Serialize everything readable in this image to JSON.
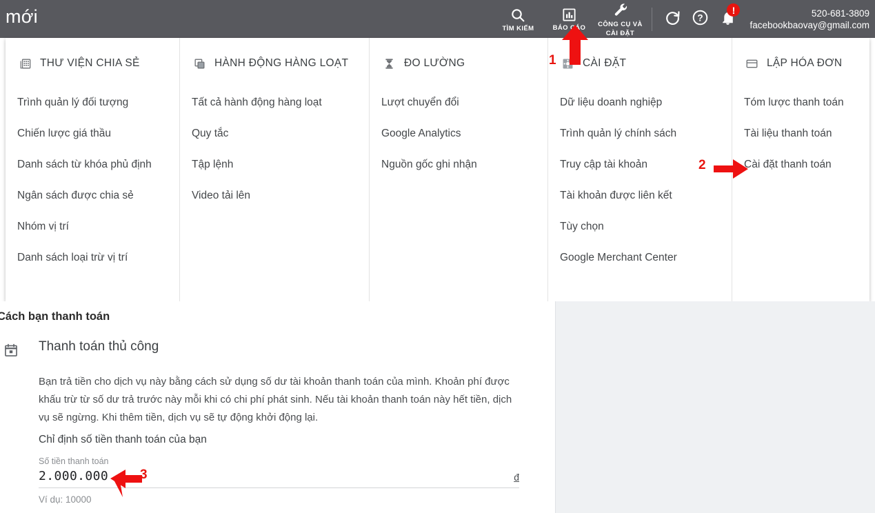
{
  "header": {
    "brand": "mới",
    "tools": [
      {
        "label": "TÌM KIẾM",
        "icon": "search-icon"
      },
      {
        "label": "BÁO CÁO",
        "icon": "reports-bar-chart-icon"
      },
      {
        "label": "CÔNG CỤ VÀ CÀI ĐẶT",
        "label_line1": "CÔNG CỤ VÀ",
        "label_line2": "CÀI ĐẶT",
        "icon": "wrench-tools-icon"
      }
    ],
    "refresh_icon": "refresh-icon",
    "help_icon": "help-question-icon",
    "notifications_icon": "bell-icon",
    "notifications_badge": "!",
    "account_id": "520-681-3809",
    "account_email": "facebookbaovay@gmail.com",
    "bar_color": "#58595e"
  },
  "megamenu": {
    "columns": [
      {
        "title": "THƯ VIỆN CHIA SẺ",
        "icon": "shared-library-grid-icon",
        "items": [
          "Trình quản lý đối tượng",
          "Chiến lược giá thầu",
          "Danh sách từ khóa phủ định",
          "Ngân sách được chia sẻ",
          "Nhóm vị trí",
          "Danh sách loại trừ vị trí"
        ]
      },
      {
        "title": "HÀNH ĐỘNG HÀNG LOẠT",
        "icon": "bulk-actions-copy-icon",
        "items": [
          "Tất cả hành động hàng loạt",
          "Quy tắc",
          "Tập lệnh",
          "Video tải lên"
        ]
      },
      {
        "title": "ĐO LƯỜNG",
        "icon": "measurement-hourglass-icon",
        "items": [
          "Lượt chuyển đổi",
          "Google Analytics",
          "Nguồn gốc ghi nhận"
        ]
      },
      {
        "title": "CÀI ĐẶT",
        "icon": "settings-gear-icon",
        "items": [
          "Dữ liệu doanh nghiệp",
          "Trình quản lý chính sách",
          "Truy cập tài khoản",
          "Tài khoản được liên kết",
          "Tùy chọn",
          "Google Merchant Center"
        ]
      },
      {
        "title": "LẬP HÓA ĐƠN",
        "icon": "billing-card-icon",
        "items": [
          "Tóm lược thanh toán",
          "Tài liệu thanh toán",
          "Cài đặt thanh toán"
        ]
      }
    ]
  },
  "content": {
    "section_title": "Cách bạn thanh toán",
    "method_icon": "calendar-event-icon",
    "method_title": "Thanh toán thủ công",
    "description": "Bạn trả tiền cho dịch vụ này bằng cách sử dụng số dư tài khoản thanh toán của mình. Khoản phí được khấu trừ từ số dư trả trước này mỗi khi có chi phí phát sinh. Nếu tài khoản thanh toán này hết tiền, dịch vụ sẽ ngừng. Khi thêm tiền, dịch vụ sẽ tự động khởi động lại.",
    "amount_heading": "Chỉ định số tiền thanh toán của bạn",
    "amount_field_label": "Số tiền thanh toán",
    "amount_value": "2.000.000",
    "amount_placeholder": "10000",
    "currency_suffix": "đ",
    "amount_hint": "Ví dụ: 10000"
  },
  "annotations": {
    "color": "#e8150f",
    "markers": [
      {
        "number": "1",
        "target": "CÔNG CỤ VÀ CÀI ĐẶT",
        "direction": "up"
      },
      {
        "number": "2",
        "target": "Cài đặt thanh toán",
        "direction": "right"
      },
      {
        "number": "3",
        "target": "2.000.000",
        "direction": "left"
      }
    ]
  }
}
